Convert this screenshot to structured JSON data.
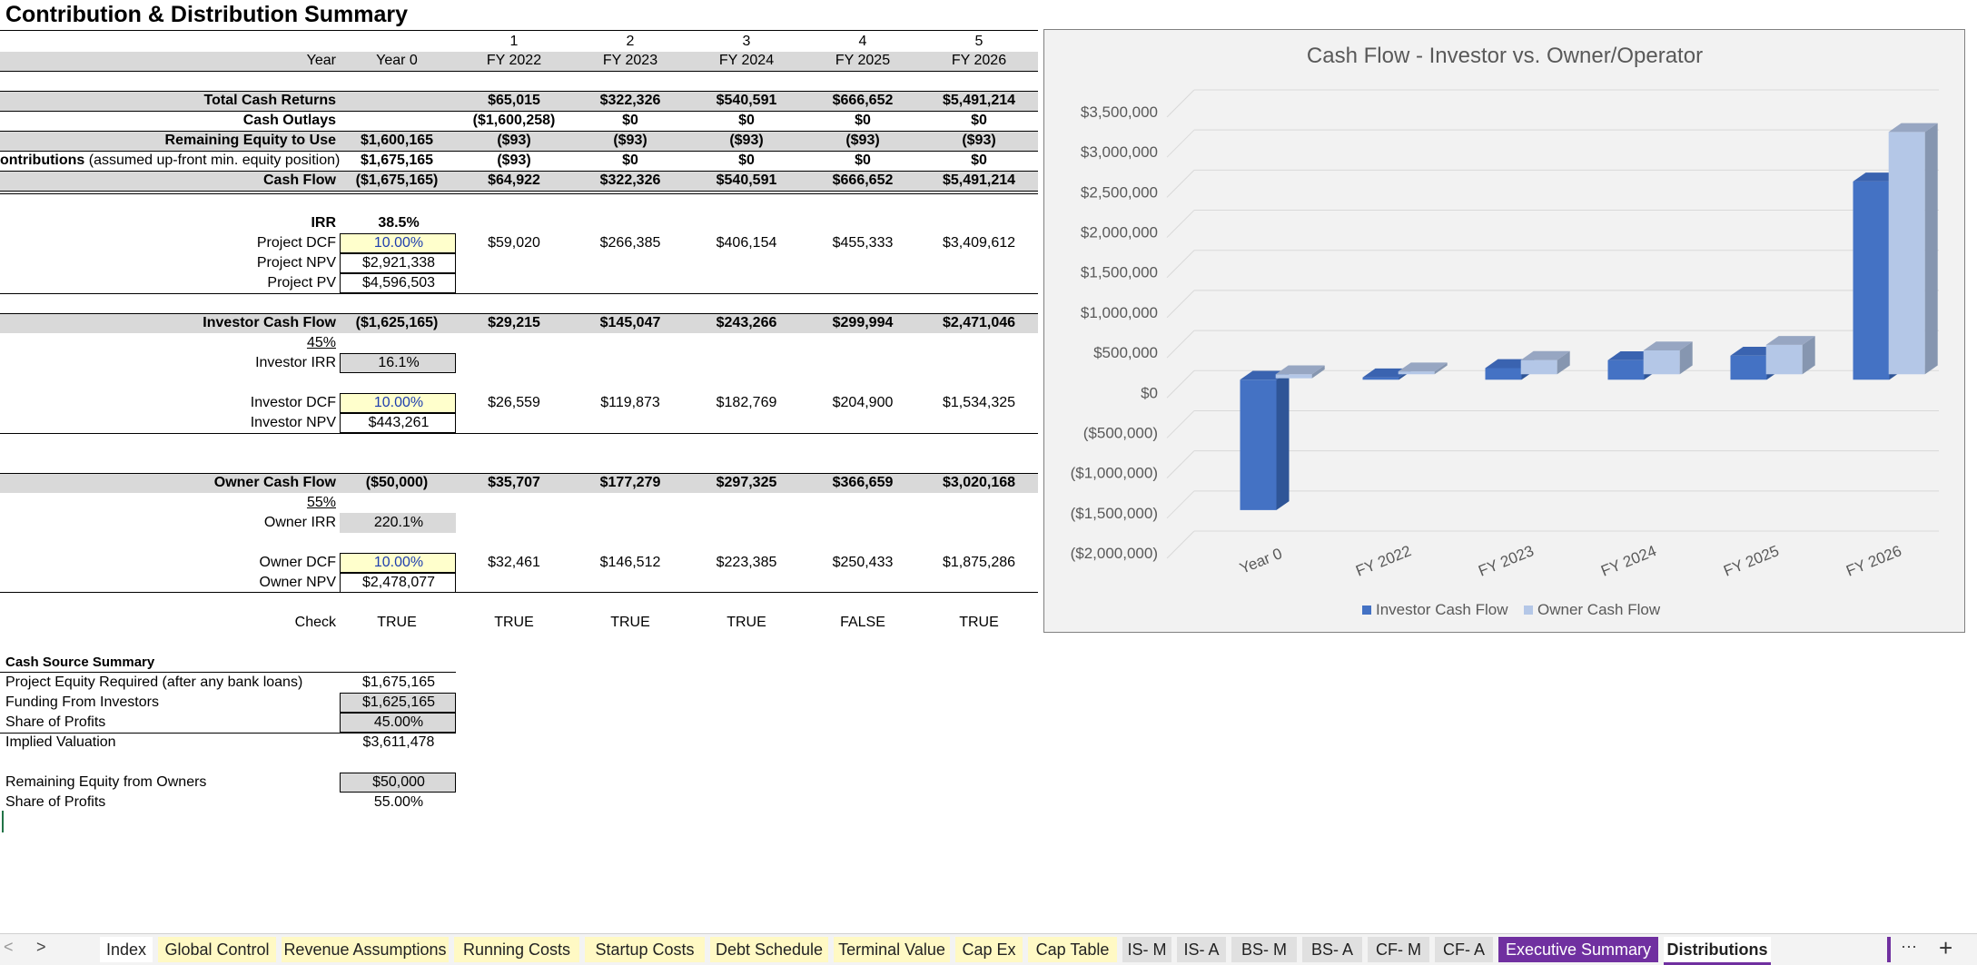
{
  "title": "Contribution & Distribution Summary",
  "header": {
    "period_numbers": [
      "1",
      "2",
      "3",
      "4",
      "5"
    ],
    "year_label": "Year",
    "years": [
      "Year 0",
      "FY 2022",
      "FY 2023",
      "FY 2024",
      "FY 2025",
      "FY 2026"
    ]
  },
  "rows": [
    {
      "label": "Total Cash Returns",
      "values": [
        "",
        "$65,015",
        "$322,326",
        "$540,591",
        "$666,652",
        "$5,491,214"
      ]
    },
    {
      "label": "Cash Outlays",
      "values": [
        "",
        "($1,600,258)",
        "$0",
        "$0",
        "$0",
        "$0"
      ]
    },
    {
      "label": "Remaining Equity to Use",
      "values": [
        "$1,600,165",
        "($93)",
        "($93)",
        "($93)",
        "($93)",
        "($93)"
      ]
    },
    {
      "label_bold": "ontributions",
      "label_rest": " (assumed up-front min. equity position)",
      "values": [
        "$1,675,165",
        "($93)",
        "$0",
        "$0",
        "$0",
        "$0"
      ]
    },
    {
      "label": "Cash Flow",
      "values": [
        "($1,675,165)",
        "$64,922",
        "$322,326",
        "$540,591",
        "$666,652",
        "$5,491,214"
      ]
    }
  ],
  "project": {
    "irr_label": "IRR",
    "irr": "38.5%",
    "dcf_label": "Project DCF",
    "dcf": "10.00%",
    "npv_label": "Project NPV",
    "npv": "$2,921,338",
    "pv_label": "Project PV",
    "pv": "$4,596,503",
    "dcf_values": [
      "$59,020",
      "$266,385",
      "$406,154",
      "$455,333",
      "$3,409,612"
    ]
  },
  "investor": {
    "cf_label": "Investor Cash Flow",
    "cf_values": [
      "($1,625,165)",
      "$29,215",
      "$145,047",
      "$243,266",
      "$299,994",
      "$2,471,046"
    ],
    "share": "45%",
    "irr_label": "Investor IRR",
    "irr": "16.1%",
    "dcf_label": "Investor DCF",
    "dcf": "10.00%",
    "npv_label": "Investor NPV",
    "npv": "$443,261",
    "dcf_values": [
      "$26,559",
      "$119,873",
      "$182,769",
      "$204,900",
      "$1,534,325"
    ]
  },
  "owner": {
    "cf_label": "Owner Cash Flow",
    "cf_values": [
      "($50,000)",
      "$35,707",
      "$177,279",
      "$297,325",
      "$366,659",
      "$3,020,168"
    ],
    "share": "55%",
    "irr_label": "Owner IRR",
    "irr": "220.1%",
    "dcf_label": "Owner DCF",
    "dcf": "10.00%",
    "npv_label": "Owner NPV",
    "npv": "$2,478,077",
    "dcf_values": [
      "$32,461",
      "$146,512",
      "$223,385",
      "$250,433",
      "$1,875,286"
    ]
  },
  "check": {
    "label": "Check",
    "values": [
      "TRUE",
      "TRUE",
      "TRUE",
      "TRUE",
      "FALSE",
      "TRUE"
    ]
  },
  "cash_source": {
    "title": "Cash Source Summary",
    "items": [
      {
        "label": "Project Equity Required (after any bank loans)",
        "value": "$1,675,165"
      },
      {
        "label": "Funding From Investors",
        "value": "$1,625,165"
      },
      {
        "label": "Share of Profits",
        "value": "45.00%"
      },
      {
        "label": "Implied Valuation",
        "value": "$3,611,478"
      },
      {
        "label": "Remaining Equity from Owners",
        "value": "$50,000"
      },
      {
        "label": "Share of Profits",
        "value": "55.00%"
      }
    ]
  },
  "chart_data": {
    "type": "bar",
    "title": "Cash Flow - Investor vs. Owner/Operator",
    "categories": [
      "Year 0",
      "FY 2022",
      "FY 2023",
      "FY 2024",
      "FY 2025",
      "FY 2026"
    ],
    "series": [
      {
        "name": "Investor Cash Flow",
        "values": [
          -1625165,
          29215,
          145047,
          243266,
          299994,
          2471046
        ],
        "color": "#4472c4"
      },
      {
        "name": "Owner Cash Flow",
        "values": [
          -50000,
          35707,
          177279,
          297325,
          366659,
          3020168
        ],
        "color": "#b4c7e7"
      }
    ],
    "yticks": [
      "$3,500,000",
      "$3,000,000",
      "$2,500,000",
      "$2,000,000",
      "$1,500,000",
      "$1,000,000",
      "$500,000",
      "$0",
      "($500,000)",
      "($1,000,000)",
      "($1,500,000)",
      "($2,000,000)"
    ],
    "ylim": [
      -2000000,
      3500000
    ],
    "legend": "bottom",
    "grid": true,
    "three_d": true
  },
  "tabs": [
    {
      "label": "Index",
      "style": "plain"
    },
    {
      "label": "Global Control",
      "style": "yellow"
    },
    {
      "label": "Revenue Assumptions",
      "style": "yellow"
    },
    {
      "label": "Running Costs",
      "style": "yellow"
    },
    {
      "label": "Startup Costs",
      "style": "yellow"
    },
    {
      "label": "Debt Schedule",
      "style": "yellow"
    },
    {
      "label": "Terminal Value",
      "style": "yellow"
    },
    {
      "label": "Cap Ex",
      "style": "yellow"
    },
    {
      "label": "Cap Table",
      "style": "yellow"
    },
    {
      "label": "IS- M",
      "style": "grey"
    },
    {
      "label": "IS- A",
      "style": "grey"
    },
    {
      "label": "BS- M",
      "style": "grey"
    },
    {
      "label": "BS- A",
      "style": "grey"
    },
    {
      "label": "CF- M",
      "style": "grey"
    },
    {
      "label": "CF- A",
      "style": "grey"
    },
    {
      "label": "Executive Summary",
      "style": "purple"
    },
    {
      "label": "Distributions",
      "style": "active"
    }
  ],
  "nav": {
    "prev": "<",
    "next": ">",
    "more": "···",
    "add": "+"
  }
}
